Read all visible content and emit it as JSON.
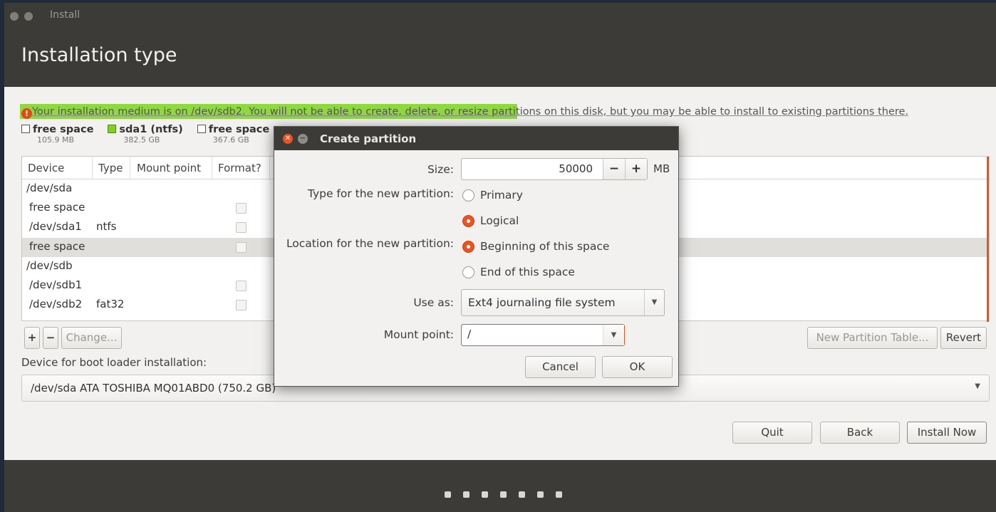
{
  "window": {
    "title": "Install"
  },
  "header": {
    "title": "Installation type"
  },
  "main": {
    "warning": "Your installation medium is on /dev/sdb2. You will not be able to create, delete, or resize partitions on this disk, but you may be able to install to existing partitions there.",
    "legend": [
      {
        "label": "free space",
        "size": "105.9 MB"
      },
      {
        "label": "sda1 (ntfs)",
        "size": "382.5 GB"
      },
      {
        "label": "free space",
        "size": "367.6 GB"
      }
    ],
    "table": {
      "headers": [
        "Device",
        "Type",
        "Mount point",
        "Format?"
      ],
      "rows": [
        {
          "device": "/dev/sda",
          "type": "",
          "indent": false
        },
        {
          "device": "free space",
          "type": "",
          "indent": true
        },
        {
          "device": "/dev/sda1",
          "type": "ntfs",
          "indent": true
        },
        {
          "device": "free space",
          "type": "",
          "indent": true
        },
        {
          "device": "/dev/sdb",
          "type": "",
          "indent": false
        },
        {
          "device": "/dev/sdb1",
          "type": "",
          "indent": true
        },
        {
          "device": "/dev/sdb2",
          "type": "fat32",
          "indent": true
        }
      ]
    },
    "toolbar": {
      "add": "+",
      "remove": "−",
      "change": "Change...",
      "new_table": "New Partition Table...",
      "revert": "Revert"
    },
    "boot": {
      "label": "Device for boot loader installation:",
      "value": "/dev/sda   ATA TOSHIBA MQ01ABD0 (750.2 GB)"
    },
    "buttons": {
      "quit": "Quit",
      "back": "Back",
      "install": "Install Now"
    }
  },
  "dialog": {
    "title": "Create partition",
    "size_label": "Size:",
    "size_value": "50000",
    "size_unit": "MB",
    "minus": "−",
    "plus": "+",
    "type_label": "Type for the new partition:",
    "type_options": [
      "Primary",
      "Logical"
    ],
    "type_selected": "Logical",
    "location_label": "Location for the new partition:",
    "location_options": [
      "Beginning of this space",
      "End of this space"
    ],
    "location_selected": "Beginning of this space",
    "use_as_label": "Use as:",
    "use_as_value": "Ext4 journaling file system",
    "mount_label": "Mount point:",
    "mount_value": "/",
    "cancel": "Cancel",
    "ok": "OK"
  },
  "colors": {
    "accent": "#e95420",
    "highlight": "#7ed321",
    "chrome": "#3c3b37"
  }
}
